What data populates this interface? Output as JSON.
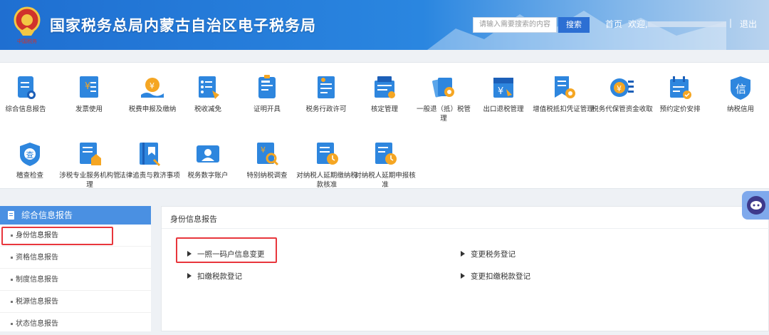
{
  "header": {
    "site_title": "国家税务总局内蒙古自治区电子税务局",
    "emblem_text": "中国税务",
    "search_placeholder": "请输入需要搜索的内容",
    "search_button": "搜索",
    "nav_home": "首页",
    "nav_welcome": "欢迎,",
    "nav_separator": "|",
    "nav_logout": "退出"
  },
  "functions": [
    {
      "label": "综合信息报告",
      "icon": "report-icon"
    },
    {
      "label": "发票使用",
      "icon": "invoice-icon"
    },
    {
      "label": "税费申报及缴纳",
      "icon": "tax-payment-icon"
    },
    {
      "label": "税收减免",
      "icon": "tax-reduction-icon"
    },
    {
      "label": "证明开具",
      "icon": "certificate-icon"
    },
    {
      "label": "税务行政许可",
      "icon": "permit-icon"
    },
    {
      "label": "核定管理",
      "icon": "assessment-icon"
    },
    {
      "label": "一般退（抵）税管理",
      "icon": "refund-icon"
    },
    {
      "label": "出口退税管理",
      "icon": "export-refund-icon"
    },
    {
      "label": "增值税抵扣凭证管理",
      "icon": "vat-voucher-icon"
    },
    {
      "label": "税务代保管资金收取",
      "icon": "custody-fund-icon"
    },
    {
      "label": "预约定价安排",
      "icon": "pricing-icon"
    },
    {
      "label": "纳税信用",
      "icon": "credit-icon"
    },
    {
      "label": "稽查检查",
      "icon": "inspection-icon"
    },
    {
      "label": "涉税专业服务机构管理",
      "icon": "agency-icon"
    },
    {
      "label": "法律追责与救济事项",
      "icon": "legal-icon"
    },
    {
      "label": "税务数字账户",
      "icon": "digital-account-icon"
    },
    {
      "label": "特别纳税调查",
      "icon": "special-investigation-icon"
    },
    {
      "label": "对纳税人延期缴纳税款核准",
      "icon": "deferred-payment-icon"
    },
    {
      "label": "对纳税人延期申报核准",
      "icon": "deferred-filing-icon"
    }
  ],
  "sidebar": {
    "header": "综合信息报告",
    "items": [
      {
        "label": "身份信息报告"
      },
      {
        "label": "资格信息报告"
      },
      {
        "label": "制度信息报告"
      },
      {
        "label": "税源信息报告"
      },
      {
        "label": "状态信息报告"
      }
    ]
  },
  "content": {
    "title": "身份信息报告",
    "links": [
      {
        "label": "一照一码户信息变更"
      },
      {
        "label": "变更税务登记"
      },
      {
        "label": "扣缴税款登记"
      },
      {
        "label": "变更扣缴税款登记"
      }
    ]
  },
  "colors": {
    "header_blue": "#1f6fd1",
    "icon_blue": "#2e86de",
    "icon_orange": "#f5a623",
    "highlight_red": "#e8363c",
    "sidebar_blue": "#4a90e2"
  }
}
